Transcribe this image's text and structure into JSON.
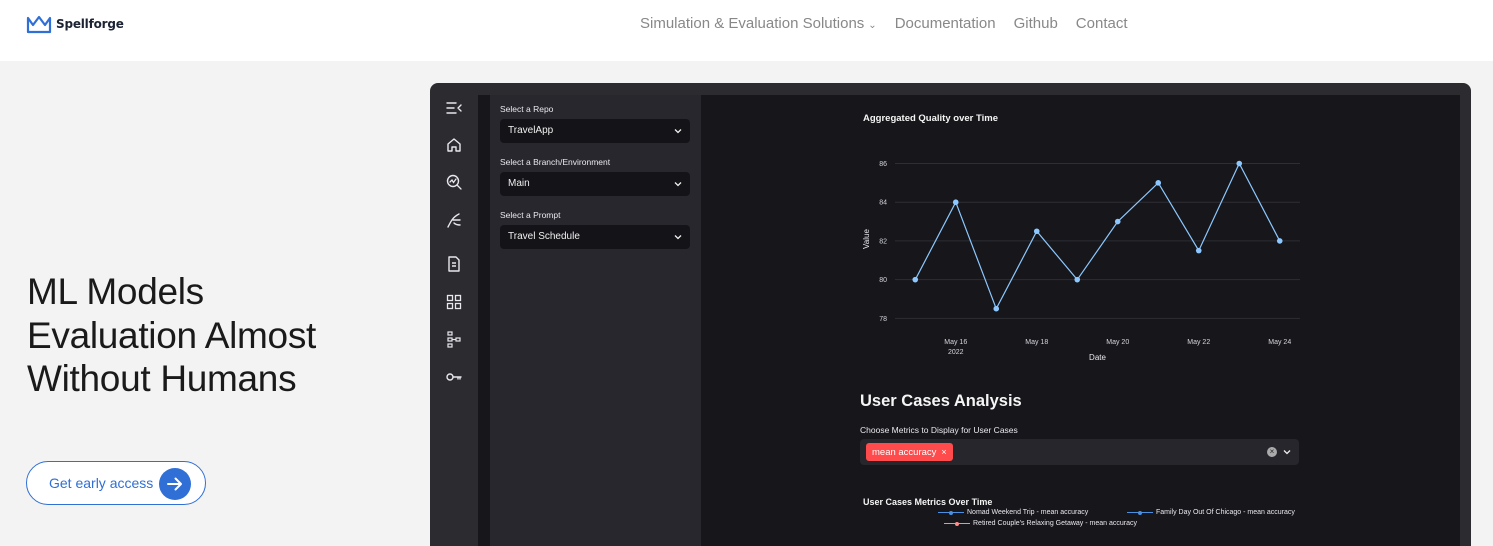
{
  "brand": {
    "name": "Spellforge",
    "color": "#2f6fd6"
  },
  "nav": {
    "items": [
      {
        "label": "Simulation & Evaluation Solutions",
        "has_dropdown": true
      },
      {
        "label": "Documentation"
      },
      {
        "label": "Github"
      },
      {
        "label": "Contact"
      }
    ]
  },
  "hero": {
    "title_lines": [
      "ML Models",
      "Evaluation Almost",
      "Without Humans"
    ],
    "cta_label": "Get early access"
  },
  "app": {
    "rail_icons": [
      "collapse-sidebar-icon",
      "home-icon",
      "search-chart-icon",
      "branch-icon",
      "document-icon",
      "dashboard-icon",
      "flow-icon",
      "key-icon"
    ],
    "repo": {
      "label": "Select a Repo",
      "value": "TravelApp"
    },
    "branch": {
      "label": "Select a Branch/Environment",
      "value": "Main"
    },
    "prompt": {
      "label": "Select a Prompt",
      "value": "Travel Schedule"
    },
    "user_cases": {
      "title": "User Cases Analysis",
      "metrics_label": "Choose Metrics to Display for User Cases",
      "selected_metric": "mean accuracy",
      "tag_remove": "×",
      "clear": "×",
      "chart_title": "User Cases Metrics Over Time",
      "legend": [
        {
          "label": "Nomad Weekend Trip - mean accuracy",
          "color": "#4a90e2"
        },
        {
          "label": "Family Day Out Of Chicago - mean accuracy",
          "color": "#4a90e2"
        },
        {
          "label": "Retired Couple's Relaxing Getaway - mean accuracy",
          "color": "#ff8c8c"
        }
      ]
    }
  },
  "chart_data": {
    "type": "line",
    "title": "Aggregated Quality over Time",
    "xlabel": "Date",
    "ylabel": "Value",
    "x": [
      "2022-05-15",
      "2022-05-16",
      "2022-05-17",
      "2022-05-18",
      "2022-05-19",
      "2022-05-20",
      "2022-05-21",
      "2022-05-22",
      "2022-05-23",
      "2022-05-24"
    ],
    "x_ticks": [
      "May 16",
      "May 18",
      "May 20",
      "May 22",
      "May 24"
    ],
    "x_tick_year": "2022",
    "y_ticks": [
      78,
      80,
      82,
      84,
      86
    ],
    "ylim": [
      77.4,
      86.8
    ],
    "series": [
      {
        "values": [
          80,
          84,
          78.5,
          82.5,
          80,
          83,
          85,
          81.5,
          86,
          82
        ],
        "color": "#8cc8ff"
      }
    ],
    "grid": true
  }
}
